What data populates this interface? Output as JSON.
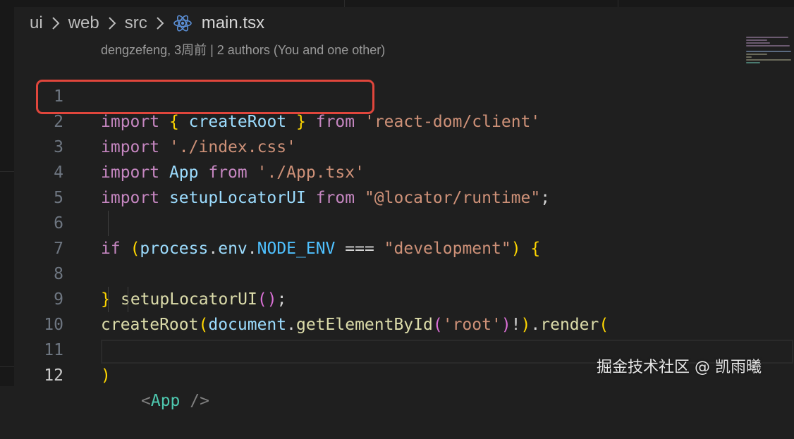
{
  "breadcrumb": {
    "segments": [
      "ui",
      "web",
      "src"
    ],
    "file": "main.tsx",
    "file_icon": "react-icon"
  },
  "blame": "dengzefeng, 3周前 | 2 authors (You and one other)",
  "lines": [
    {
      "n": "1"
    },
    {
      "n": "2"
    },
    {
      "n": "3"
    },
    {
      "n": "4"
    },
    {
      "n": "5"
    },
    {
      "n": "6"
    },
    {
      "n": "7"
    },
    {
      "n": "8"
    },
    {
      "n": "9"
    },
    {
      "n": "10"
    },
    {
      "n": "11"
    },
    {
      "n": "12"
    }
  ],
  "code": {
    "l1": {
      "kw": "import",
      "ob": "{",
      "name": "createRoot",
      "cb": "}",
      "from": "from",
      "src": "'react-dom/client'"
    },
    "l2": {
      "kw": "import",
      "src": "'./index.css'"
    },
    "l3": {
      "kw": "import",
      "name": "App",
      "from": "from",
      "src": "'./App.tsx'"
    },
    "l4": {
      "kw": "import",
      "name": "setupLocatorUI",
      "from": "from",
      "src": "\"@locator/runtime\"",
      "semi": ";"
    },
    "l6": {
      "kw": "if",
      "op": "(",
      "obj": "process",
      "dot1": ".",
      "prop": "env",
      "dot2": ".",
      "const": "NODE_ENV",
      "eq": "===",
      "str": "\"development\"",
      "cp": ")",
      "ob": "{"
    },
    "l7": {
      "fn": "setupLocatorUI",
      "paren": "()",
      "semi": ";"
    },
    "l8": {
      "cb": "}"
    },
    "l9": {
      "fn": "createRoot",
      "op": "(",
      "obj": "document",
      "dot": ".",
      "method": "getElementById",
      "op2": "(",
      "str": "'root'",
      "cp2": ")",
      "bang": "!",
      "cp": ")",
      "dot2": ".",
      "render": "render",
      "op3": "("
    },
    "l10": {
      "lt": "<",
      "tag": "App",
      "close": " />"
    },
    "l11": {
      "cp": ")"
    }
  },
  "watermark": "掘金技术社区 @ 凯雨曦",
  "colors": {
    "background": "#1f1f1f",
    "highlight_box": "#e0463c",
    "keyword": "#c586c0",
    "string": "#ce9178",
    "variable": "#9cdcfe",
    "function": "#dcdcaa"
  }
}
